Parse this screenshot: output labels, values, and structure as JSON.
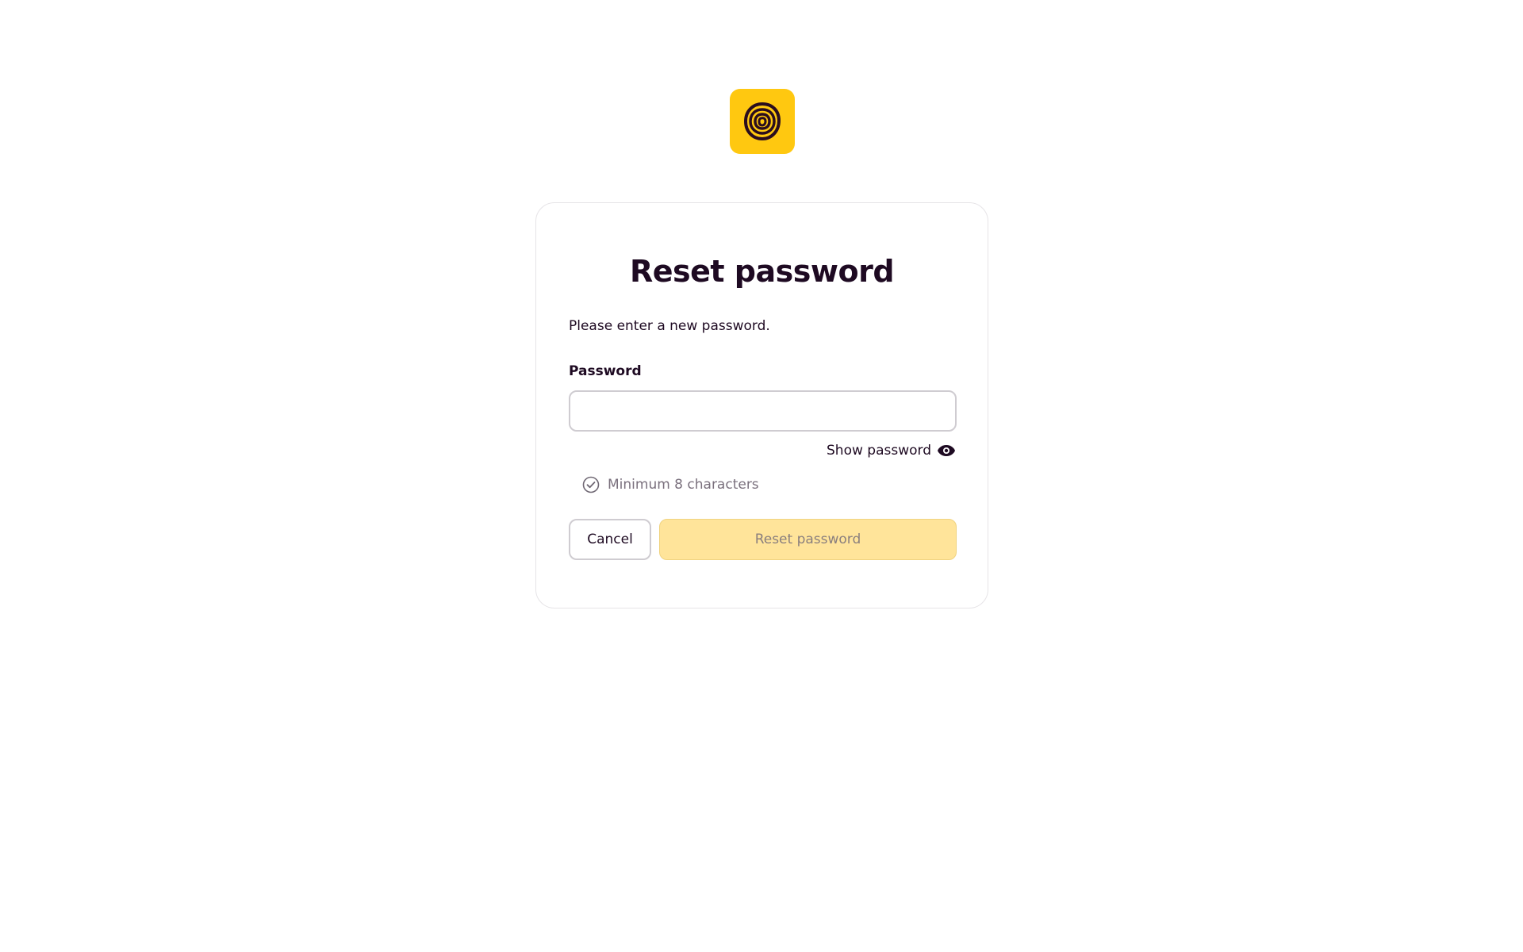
{
  "brand": {
    "logo_icon": "spiral-rings-icon",
    "accent_color": "#ffc810"
  },
  "card": {
    "title": "Reset password",
    "subtitle": "Please enter a new password."
  },
  "password_field": {
    "label": "Password",
    "value": "",
    "placeholder": ""
  },
  "show_password": {
    "label": "Show password",
    "icon": "eye-icon"
  },
  "requirements": [
    {
      "text": "Minimum 8 characters",
      "icon": "check-circle-icon",
      "met": false
    }
  ],
  "actions": {
    "cancel_label": "Cancel",
    "submit_label": "Reset password",
    "submit_color": "#ffe49a"
  }
}
